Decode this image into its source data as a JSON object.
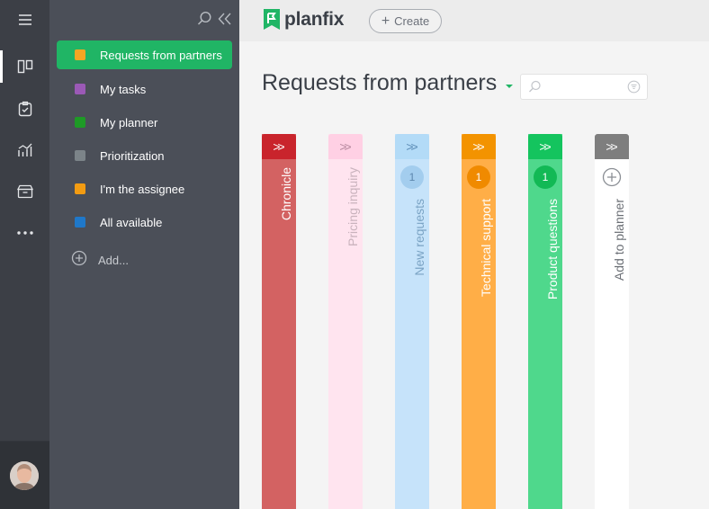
{
  "app": {
    "brand": "planfix"
  },
  "topbar": {
    "create_label": "Create"
  },
  "sidebar": {
    "items": [
      {
        "label": "Requests from partners",
        "color": "#f5a623",
        "active": true
      },
      {
        "label": "My tasks",
        "color": "#9b59b6",
        "active": false
      },
      {
        "label": "My planner",
        "color": "#1e9a26",
        "active": false
      },
      {
        "label": "Prioritization",
        "color": "#7c8489",
        "active": false
      },
      {
        "label": "I'm the assignee",
        "color": "#f39c12",
        "active": false
      },
      {
        "label": "All available",
        "color": "#1f78c9",
        "active": false
      }
    ],
    "add_label": "Add..."
  },
  "main": {
    "title": "Requests from partners",
    "search": {
      "placeholder": ""
    },
    "columns": [
      {
        "label": "Chronicle",
        "count": "",
        "header_color": "#c9242c",
        "body_color": "#d36262",
        "text_color": "#ffffff",
        "arrow_color": "#ffffff"
      },
      {
        "label": "Pricing inquiry",
        "count": "",
        "header_color": "#ffd0e4",
        "body_color": "#ffe4ef",
        "text_color": "#c9b3bd",
        "arrow_color": "#b88aa0"
      },
      {
        "label": "New requests",
        "count": "1",
        "header_color": "#b3dbf7",
        "body_color": "#c6e3fa",
        "text_color": "#7aa3c4",
        "arrow_color": "#5f8fb8",
        "badge_bg": "#a3cdee",
        "badge_color": "#5d87ad"
      },
      {
        "label": "Technical support",
        "count": "1",
        "header_color": "#f39300",
        "body_color": "#ffae47",
        "text_color": "#ffffff",
        "arrow_color": "#ffffff",
        "badge_bg": "#f08a00",
        "badge_color": "#ffffff"
      },
      {
        "label": "Product questions",
        "count": "1",
        "header_color": "#14c45e",
        "body_color": "#4fd88c",
        "text_color": "#ffffff",
        "arrow_color": "#ffffff",
        "badge_bg": "#12b955",
        "badge_color": "#ffffff"
      },
      {
        "label": "Add to planner",
        "count": "",
        "header_color": "#7e7e7e",
        "body_color": "#ffffff",
        "text_color": "#6b6f75",
        "arrow_color": "#ffffff"
      }
    ]
  }
}
